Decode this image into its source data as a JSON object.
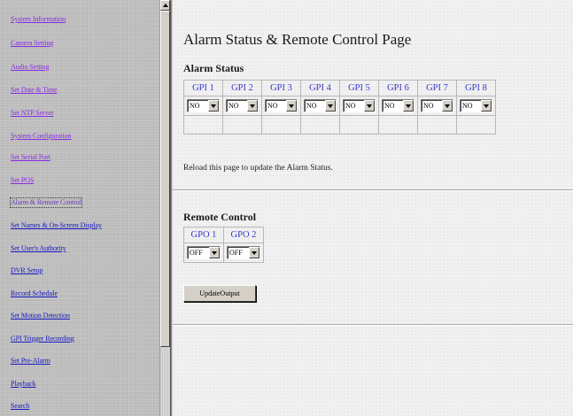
{
  "sidebar": {
    "items": [
      {
        "label": "System Information",
        "state": "visited"
      },
      {
        "label": "Camera Setting",
        "state": "visited"
      },
      {
        "label": "Audio Setting",
        "state": "visited"
      },
      {
        "label": "Set Date & Time",
        "state": "visited"
      },
      {
        "label": "Set NTP Server",
        "state": "visited"
      },
      {
        "label": "System Configuration",
        "state": "visited"
      },
      {
        "label": "Set Serial Port",
        "state": "visited"
      },
      {
        "label": "Set POS",
        "state": "visited"
      },
      {
        "label": "Alarm & Remote Control",
        "state": "active"
      },
      {
        "label": "Set Names & On-Screen Display",
        "state": "link"
      },
      {
        "label": "Set User's Authority",
        "state": "link"
      },
      {
        "label": "DVR Setup",
        "state": "link"
      },
      {
        "label": "Record Schedule",
        "state": "link"
      },
      {
        "label": "Set Motion Detection",
        "state": "link"
      },
      {
        "label": "GPI Trigger Recording",
        "state": "link"
      },
      {
        "label": "Set Pre-Alarm",
        "state": "link"
      },
      {
        "label": "Playback",
        "state": "link"
      },
      {
        "label": "Search",
        "state": "link"
      }
    ]
  },
  "page": {
    "title": "Alarm Status & Remote Control Page"
  },
  "alarm_status": {
    "title": "Alarm Status",
    "columns": [
      "GPI 1",
      "GPI 2",
      "GPI 3",
      "GPI 4",
      "GPI 5",
      "GPI 6",
      "GPI 7",
      "GPI 8"
    ],
    "values": [
      "NO",
      "NO",
      "NO",
      "NO",
      "NO",
      "NO",
      "NO",
      "NO"
    ],
    "reload_note": "Reload this page to update the Alarm Status."
  },
  "remote_control": {
    "title": "Remote Control",
    "columns": [
      "GPO 1",
      "GPO 2"
    ],
    "values": [
      "OFF",
      "OFF"
    ],
    "update_button": "UpdateOutput"
  },
  "colors": {
    "sidebar_bg": "#bcbcbc",
    "link": "#1818c0",
    "visited_link": "#8a2be2",
    "header_text": "#3838c8",
    "main_bg": "#f1f1f1"
  }
}
